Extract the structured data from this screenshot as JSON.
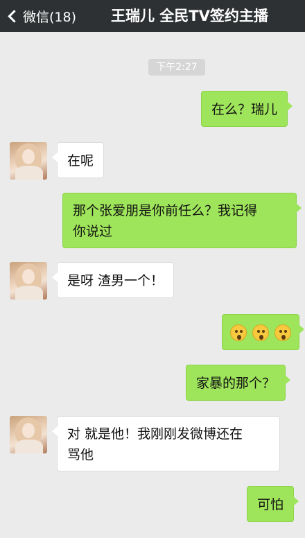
{
  "header": {
    "back_label": "微信(18)",
    "title": "王瑞儿 全民TV签约主播"
  },
  "timestamp": "下午2:27",
  "messages": [
    {
      "from": "me",
      "text": "在么？瑞儿"
    },
    {
      "from": "them",
      "text": "在呢"
    },
    {
      "from": "me",
      "text_line1": "那个张爱朋是你前任么？我记得",
      "text_line2": "你说过"
    },
    {
      "from": "them",
      "text": "是呀 渣男一个！"
    },
    {
      "from": "me",
      "emoji": [
        "scared-face",
        "scared-face",
        "scared-face"
      ]
    },
    {
      "from": "me",
      "text": "家暴的那个？"
    },
    {
      "from": "them",
      "text_line1": "对 就是他！我刚刚发微博还在",
      "text_line2": "骂他"
    },
    {
      "from": "me",
      "text": "可怕"
    }
  ],
  "colors": {
    "nav_bg": "#2e3133",
    "chat_bg": "#ebebeb",
    "my_bubble": "#9fe55b",
    "their_bubble": "#ffffff"
  }
}
